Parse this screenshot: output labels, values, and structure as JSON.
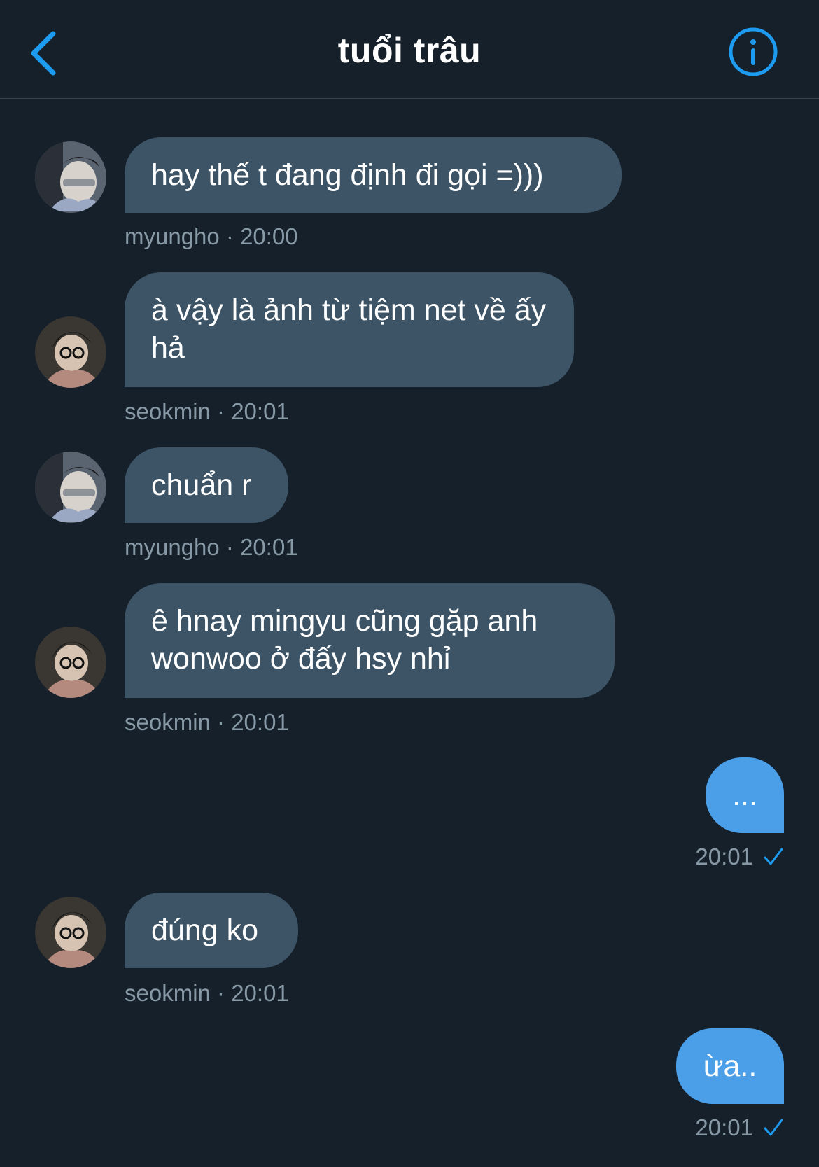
{
  "header": {
    "title": "tuổi trâu",
    "back_icon": "chevron-left-icon",
    "info_icon": "info-icon",
    "accent": "#1d9bf0"
  },
  "messages": [
    {
      "sender": "myungho",
      "text": "hay thế t đang định đi gọi =)))",
      "meta": "myungho · 20:00",
      "direction": "in"
    },
    {
      "sender": "seokmin",
      "text": "à vậy là ảnh từ tiệm net về ấy hả",
      "meta": "seokmin · 20:01",
      "direction": "in"
    },
    {
      "sender": "myungho",
      "text": "chuẩn r",
      "meta": "myungho · 20:01",
      "direction": "in"
    },
    {
      "sender": "seokmin",
      "text": "ê hnay mingyu cũng gặp anh wonwoo ở đấy hsy nhỉ",
      "meta": "seokmin · 20:01",
      "direction": "in"
    },
    {
      "text": "...",
      "meta": "20:01",
      "direction": "out",
      "status_icon": "check-icon"
    },
    {
      "sender": "seokmin",
      "text": "đúng ko",
      "meta": "seokmin · 20:01",
      "direction": "in"
    },
    {
      "text": "ừa..",
      "meta": "20:01",
      "direction": "out",
      "status_icon": "check-icon"
    }
  ],
  "colors": {
    "background": "#15202b",
    "incoming_bubble": "#3d5466",
    "outgoing_bubble": "#4a9fe8",
    "meta_text": "#8899a6"
  }
}
